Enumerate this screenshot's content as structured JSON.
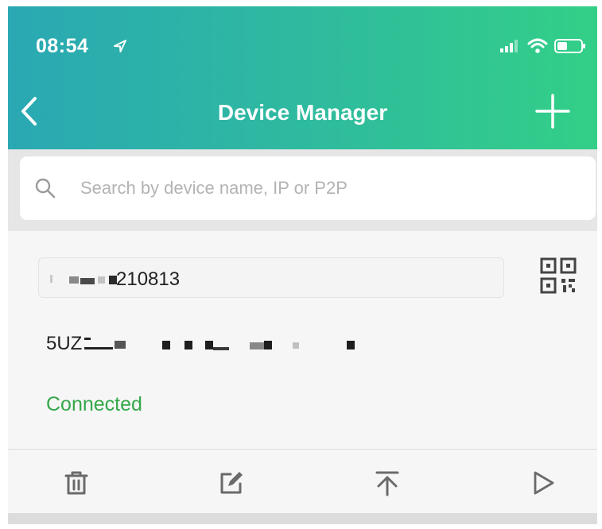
{
  "status_bar": {
    "time": "08:54",
    "icons": [
      "location-arrow-icon",
      "signal-icon",
      "wifi-icon",
      "battery-icon"
    ]
  },
  "nav": {
    "title": "Device Manager",
    "back_icon": "chevron-left-icon",
    "add_icon": "plus-icon"
  },
  "search": {
    "placeholder": "Search by device name, IP or P2P",
    "value": ""
  },
  "device": {
    "name_visible_suffix": "210813",
    "p2p_visible_prefix": "5UZ",
    "status": "Connected"
  },
  "actions": [
    {
      "name": "delete",
      "icon": "trash-icon"
    },
    {
      "name": "edit",
      "icon": "edit-icon"
    },
    {
      "name": "pin-top",
      "icon": "pin-to-top-icon"
    },
    {
      "name": "play",
      "icon": "play-icon"
    }
  ],
  "colors": {
    "header_start": "#2aa8b3",
    "header_end": "#33cf87",
    "status_connected": "#35a84a",
    "icon_gray": "#6a6a6a"
  }
}
